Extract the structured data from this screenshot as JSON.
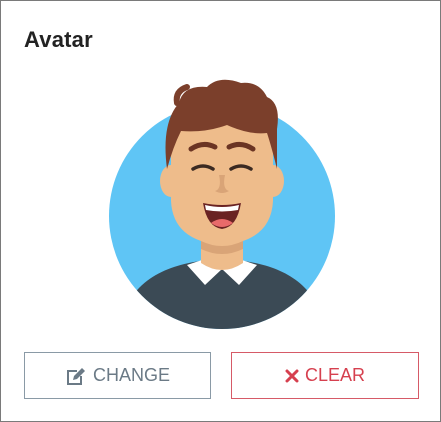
{
  "card": {
    "title": "Avatar"
  },
  "avatar": {
    "icon": "avatar-smiling-man",
    "bg_color": "#5fc5f5",
    "skin_color": "#eebc8b",
    "hair_color": "#7b3f2b",
    "shirt_color": "#3b4a55"
  },
  "buttons": {
    "change_label": "CHANGE",
    "change_icon": "edit-icon",
    "clear_label": "CLEAR",
    "clear_icon": "close-icon",
    "clear_color": "#d6404f"
  }
}
